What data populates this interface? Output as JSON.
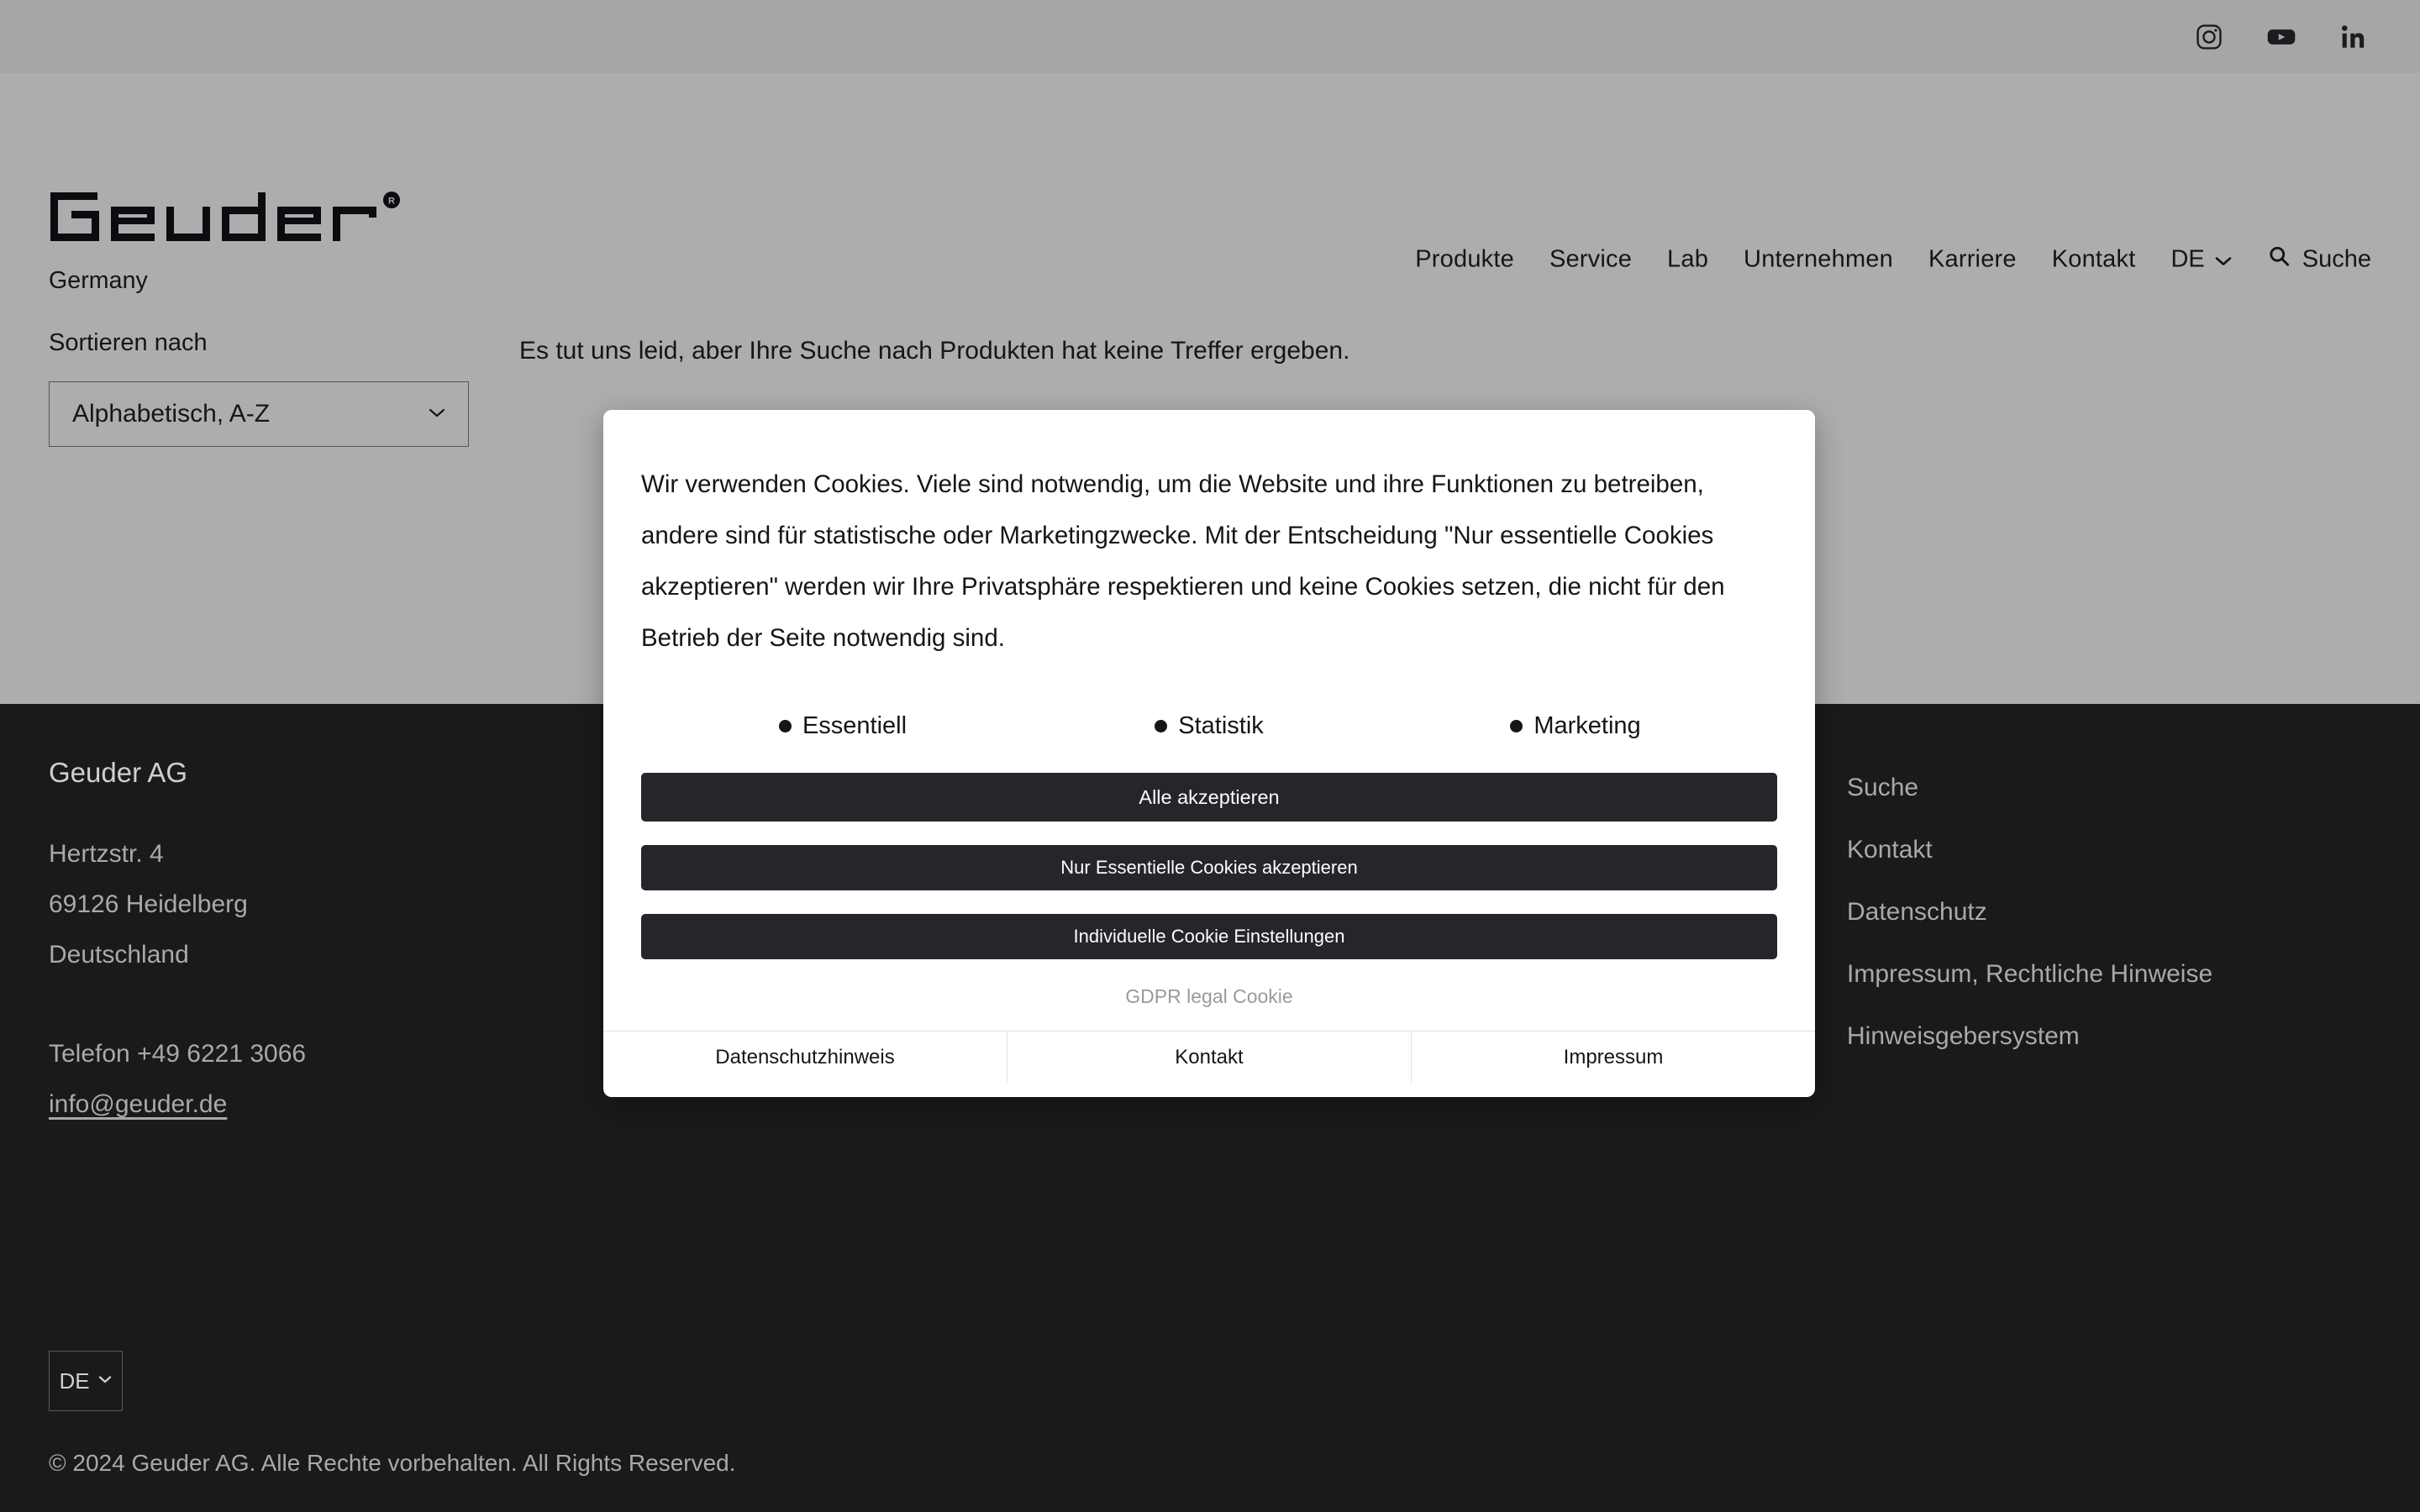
{
  "topbar": {
    "social": [
      {
        "name": "instagram-icon",
        "label": "Instagram"
      },
      {
        "name": "youtube-icon",
        "label": "YouTube"
      },
      {
        "name": "linkedin-icon",
        "label": "LinkedIn"
      }
    ]
  },
  "header": {
    "logo_text": "Geuder",
    "logo_trademark": "®",
    "subtitle": "Germany",
    "nav": [
      {
        "label": "Produkte"
      },
      {
        "label": "Service"
      },
      {
        "label": "Lab"
      },
      {
        "label": "Unternehmen"
      },
      {
        "label": "Karriere"
      },
      {
        "label": "Kontakt"
      }
    ],
    "language": "DE",
    "search_label": "Suche"
  },
  "content": {
    "sort_label": "Sortieren nach",
    "sort_value": "Alphabetisch, A-Z",
    "no_results": "Es tut uns leid, aber Ihre Suche nach Produkten hat keine Treffer ergeben."
  },
  "cookie": {
    "text": "Wir verwenden Cookies. Viele sind notwendig, um die Website und ihre Funktionen zu betreiben, andere sind für statistische oder Marketingzwecke. Mit der Entscheidung \"Nur essentielle Cookies akzeptieren\" werden wir Ihre Privatsphäre respektieren und keine Cookies setzen, die nicht für den Betrieb der Seite notwendig sind.",
    "categories": [
      {
        "label": "Essentiell"
      },
      {
        "label": "Statistik"
      },
      {
        "label": "Marketing"
      }
    ],
    "accept_all": "Alle akzeptieren",
    "accept_essential": "Nur Essentielle Cookies akzeptieren",
    "individual_settings": "Individuelle Cookie Einstellungen",
    "gdpr_note": "GDPR legal Cookie",
    "links": [
      {
        "label": "Datenschutzhinweis"
      },
      {
        "label": "Kontakt"
      },
      {
        "label": "Impressum"
      }
    ]
  },
  "footer": {
    "company": "Geuder AG",
    "address": [
      "Hertzstr. 4",
      "69126 Heidelberg",
      "Deutschland"
    ],
    "phone": "Telefon +49 6221 3066",
    "email": "info@geuder.de",
    "links": [
      {
        "label": "Suche"
      },
      {
        "label": "Kontakt"
      },
      {
        "label": "Datenschutz"
      },
      {
        "label": "Impressum, Rechtliche Hinweise"
      },
      {
        "label": "Hinweisgebersystem"
      }
    ],
    "language": "DE",
    "copyright": "© 2024 Geuder AG. Alle Rechte vorbehalten. All Rights Reserved."
  }
}
